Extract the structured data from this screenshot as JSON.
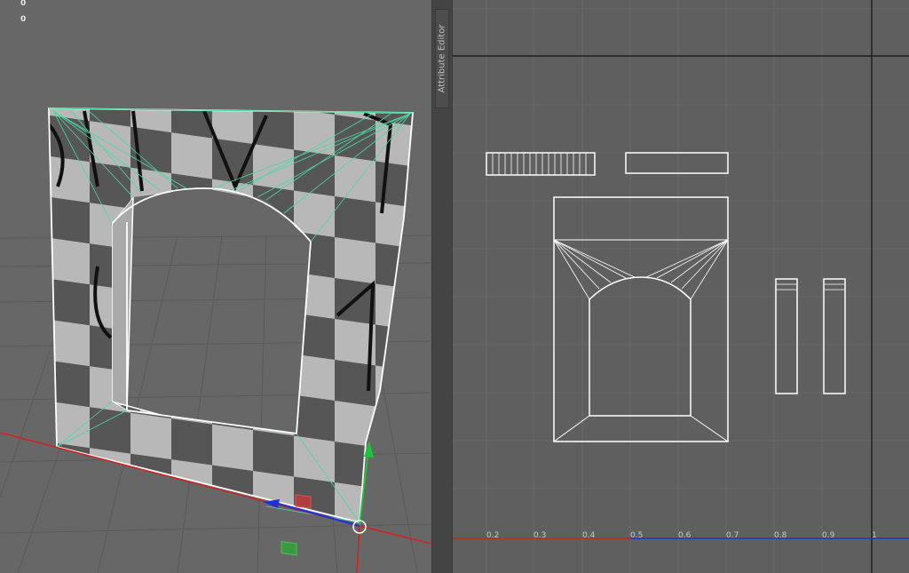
{
  "viewport": {
    "hud_lines": [
      "0",
      "0"
    ]
  },
  "side_panel": {
    "tab_label": "Attribute Editor"
  },
  "uv_editor": {
    "ruler_labels": [
      "0.2",
      "0.3",
      "0.4",
      "0.5",
      "0.6",
      "0.7",
      "0.8",
      "0.9",
      "1"
    ]
  },
  "colors": {
    "uv_background": "#5f5f5f",
    "wireframe": "#ffffff",
    "selection_edges": "#4cd9a0",
    "axis_x": "#d42020",
    "axis_y": "#20c040",
    "axis_z": "#2030d8"
  }
}
